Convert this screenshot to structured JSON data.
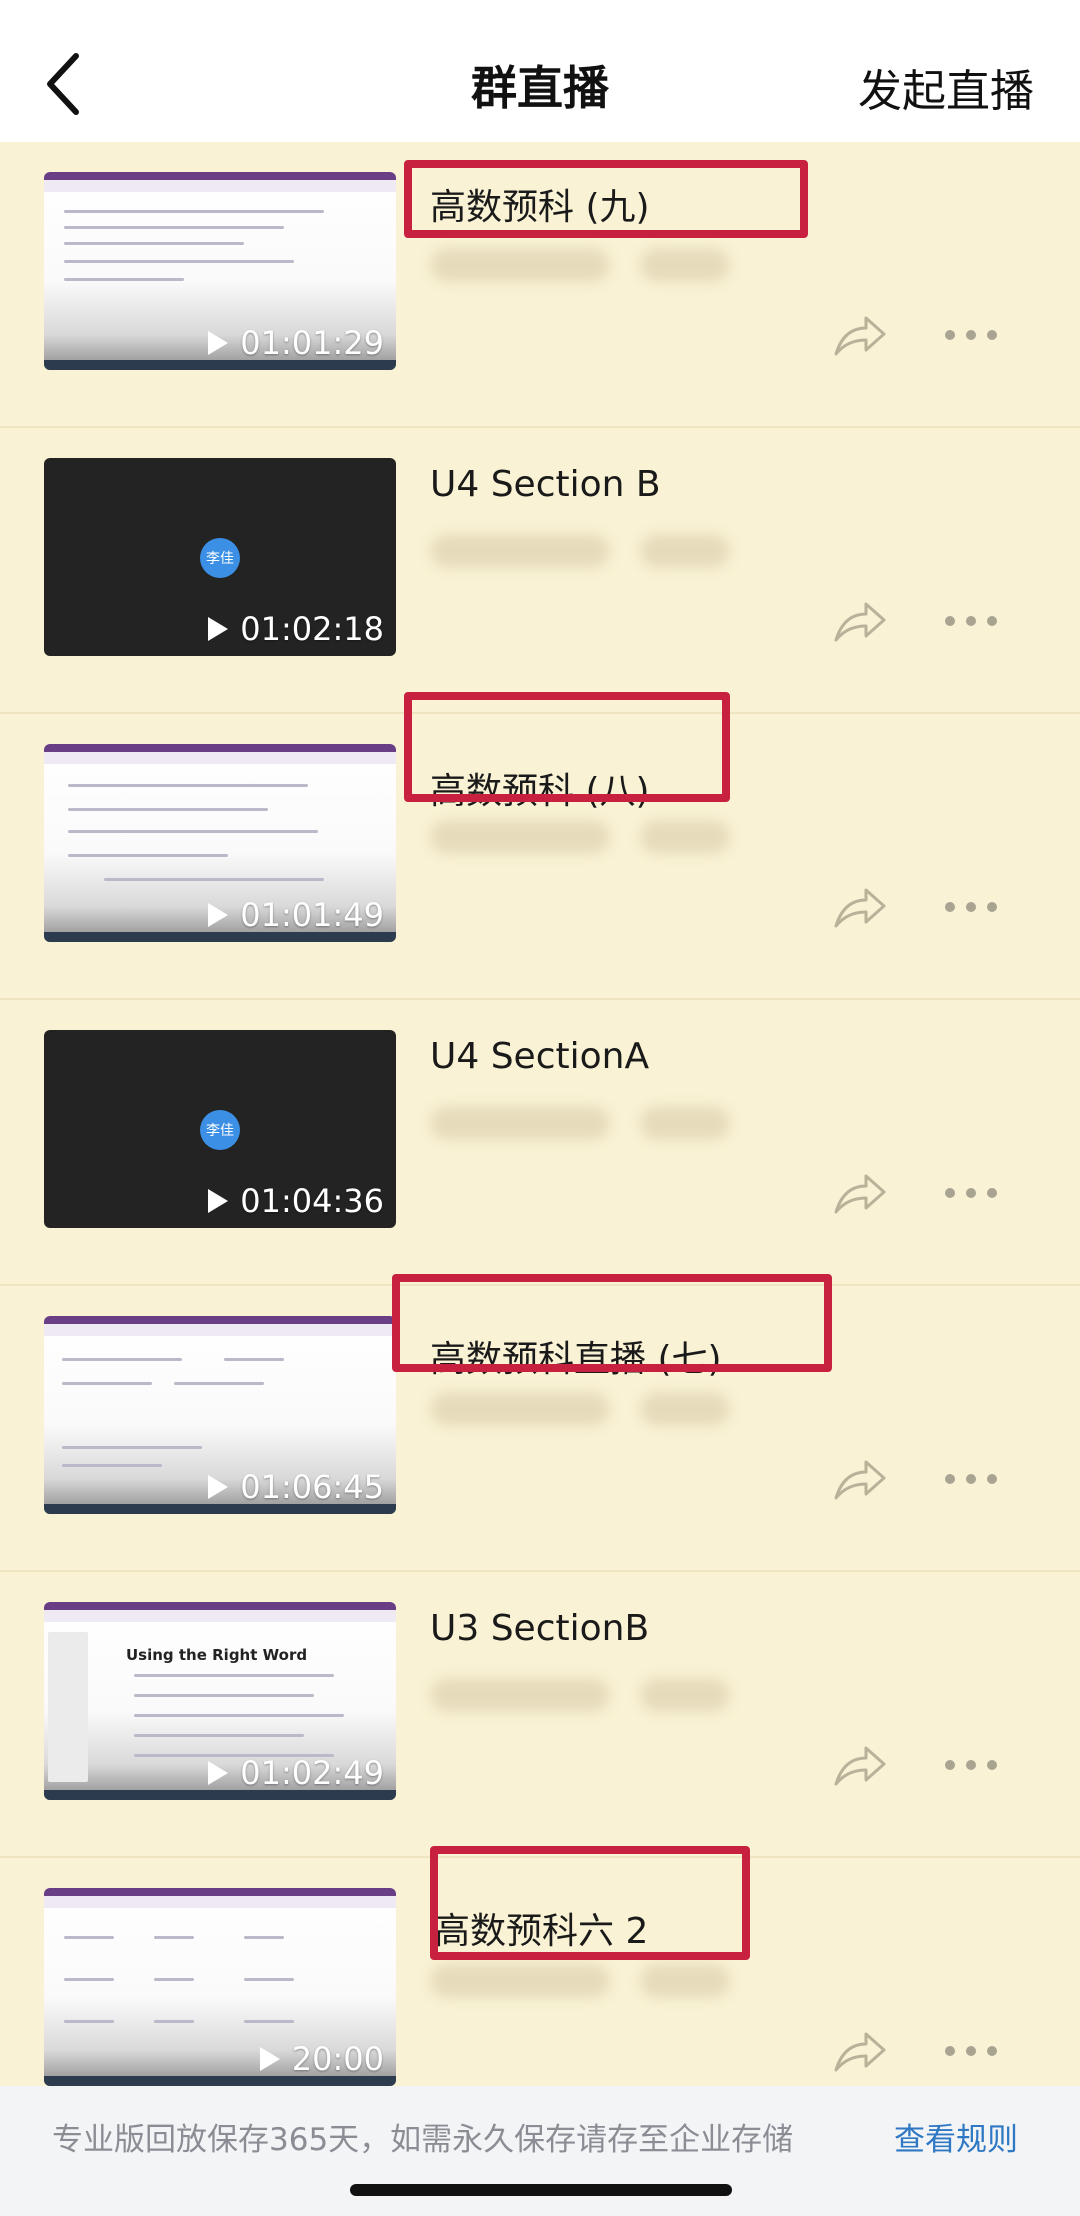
{
  "header": {
    "title": "群直播",
    "action_label": "发起直播"
  },
  "items": [
    {
      "title": "高数预科 (九)",
      "duration": "01:01:29",
      "thumb_type": "screen",
      "highlighted": true
    },
    {
      "title": "U4 Section B",
      "duration": "01:02:18",
      "thumb_type": "dark",
      "avatar_text": "李佳",
      "highlighted": false
    },
    {
      "title": "高数预科 (八)",
      "duration": "01:01:49",
      "thumb_type": "screen",
      "highlighted": true
    },
    {
      "title": "U4 SectionA",
      "duration": "01:04:36",
      "thumb_type": "dark",
      "avatar_text": "李佳",
      "highlighted": false
    },
    {
      "title": "高数预科直播 (七)",
      "duration": "01:06:45",
      "thumb_type": "screen",
      "highlighted": true
    },
    {
      "title": "U3 SectionB",
      "duration": "01:02:49",
      "thumb_type": "screen",
      "thumb_text": "Using the Right Word",
      "highlighted": false
    },
    {
      "title": "高数预科六 2",
      "duration": "20:00",
      "thumb_type": "screen",
      "highlighted": true
    }
  ],
  "footer": {
    "notice": "专业版回放保存365天，如需永久保存请存至企业存储",
    "link_label": "查看规则"
  },
  "icons": {
    "back": "chevron-left-icon",
    "play": "play-icon",
    "share": "share-arrow-icon",
    "more": "more-dots-icon"
  },
  "colors": {
    "background": "#f9f2d4",
    "highlight": "#c8203f",
    "link": "#2f78c4",
    "avatar": "#3b8fe5"
  }
}
